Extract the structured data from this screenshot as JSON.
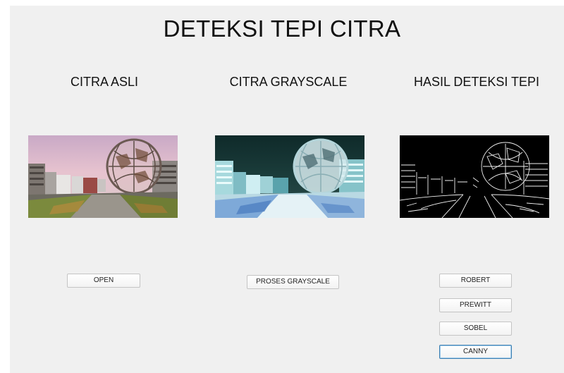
{
  "app": {
    "title": "DETEKSI TEPI CITRA"
  },
  "panels": [
    {
      "title": "CITRA ASLI",
      "image": "original-color-image"
    },
    {
      "title": "CITRA GRAYSCALE",
      "image": "grayscale-processed-image"
    },
    {
      "title": "HASIL DETEKSI TEPI",
      "image": "edge-detection-result-image"
    }
  ],
  "buttons": {
    "open": "OPEN",
    "grayscale": "PROSES GRAYSCALE",
    "robert": "ROBERT",
    "prewitt": "PREWITT",
    "sobel": "SOBEL",
    "canny": "CANNY"
  },
  "focused_button": "CANNY",
  "colors": {
    "background": "#f0f0f0",
    "edge_background": "#000000",
    "focus_border": "#3c7fb1"
  }
}
